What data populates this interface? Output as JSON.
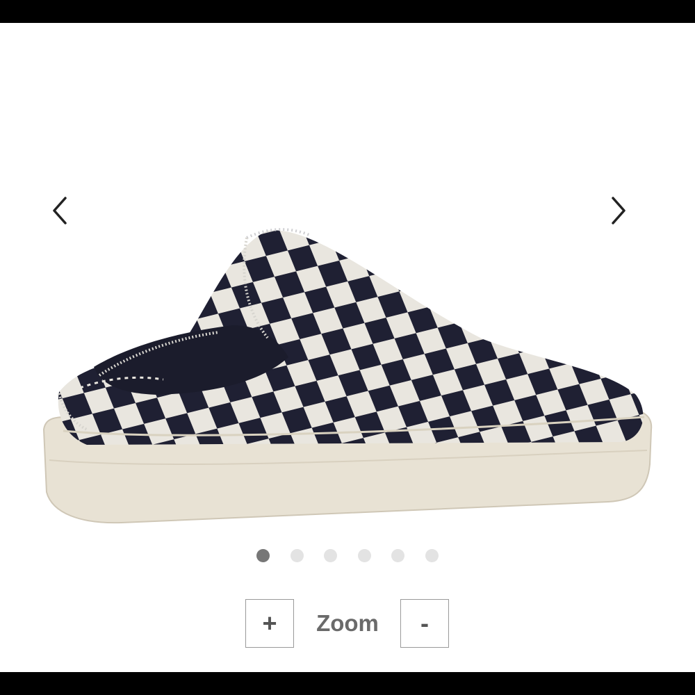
{
  "carousel": {
    "prev_icon": "chevron-left-icon",
    "next_icon": "chevron-right-icon",
    "image_alt": "",
    "slide_count": 6,
    "active_slide": 1
  },
  "zoom": {
    "zoom_in_label": "+",
    "label": "Zoom",
    "zoom_out_label": "-"
  },
  "colors": {
    "dot_active": "#777777",
    "dot_inactive": "#e3e3e3",
    "checker_dark": "#1f2033",
    "checker_light": "#e9e6df",
    "sole": "#e8e2d4"
  }
}
